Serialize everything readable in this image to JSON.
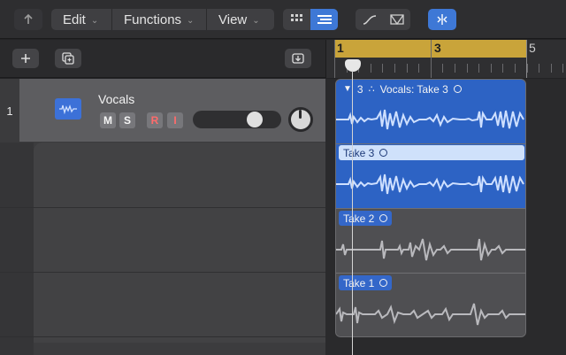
{
  "toolbar": {
    "back_icon": "up-arrow-icon",
    "menus": [
      {
        "label": "Edit"
      },
      {
        "label": "Functions"
      },
      {
        "label": "View"
      }
    ],
    "accent": "#3e78d6"
  },
  "left_header": {
    "add_icon": "plus-icon",
    "duplicate_icon": "duplicate-track-icon",
    "download_icon": "download-icon"
  },
  "ruler": {
    "bars": [
      "1",
      "3",
      "5"
    ],
    "cycle_color": "#c9a43a"
  },
  "track": {
    "number": "1",
    "name": "Vocals",
    "buttons": {
      "mute": "M",
      "solo": "S",
      "record": "R",
      "input": "I"
    },
    "icon": "waveform-icon",
    "color": "#3c71d8"
  },
  "comp": {
    "header_count": "3",
    "header_title": "Vocals: Take 3",
    "takes": [
      {
        "label": "Take 3",
        "active": true
      },
      {
        "label": "Take 2",
        "active": false
      },
      {
        "label": "Take 1",
        "active": false
      }
    ]
  }
}
